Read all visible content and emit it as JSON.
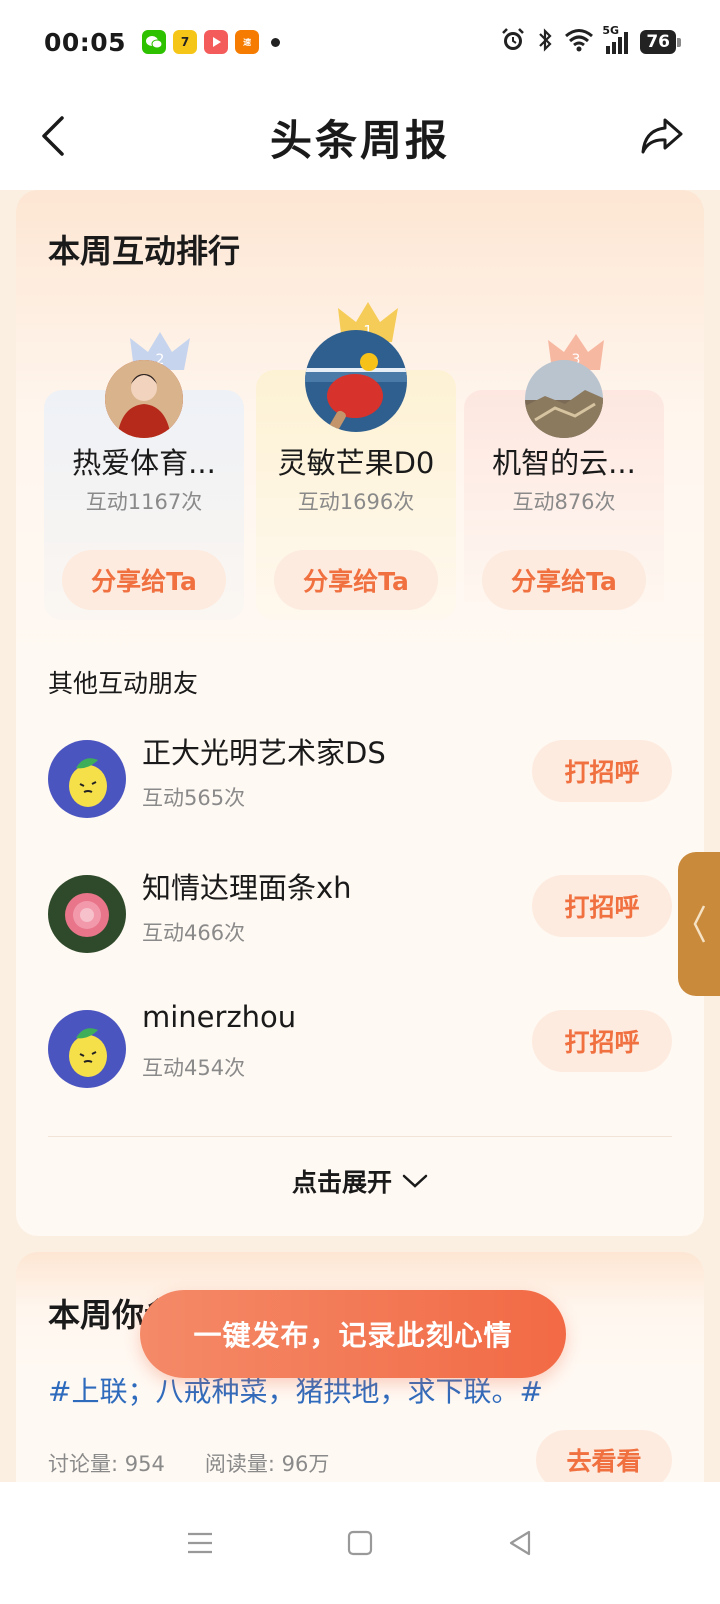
{
  "status_bar": {
    "time": "00:05",
    "battery": "76",
    "network": "5G",
    "apps": [
      "wechat-icon",
      "app-7-icon",
      "video-app-icon",
      "news-app-icon"
    ]
  },
  "header": {
    "title": "头条周报"
  },
  "weekly_ranking": {
    "title": "本周互动排行",
    "top": [
      {
        "rank": "2",
        "name": "热爱体育...",
        "count": "互动1167次",
        "share_label": "分享给Ta"
      },
      {
        "rank": "1",
        "name": "灵敏芒果D0",
        "count": "互动1696次",
        "share_label": "分享给Ta"
      },
      {
        "rank": "3",
        "name": "机智的云...",
        "count": "互动876次",
        "share_label": "分享给Ta"
      }
    ],
    "other_title": "其他互动朋友",
    "others": [
      {
        "name": "正大光明艺术家DS",
        "count": "互动565次",
        "greet_label": "打招呼"
      },
      {
        "name": "知情达理面条xh",
        "count": "互动466次",
        "greet_label": "打招呼"
      },
      {
        "name": "minerzhou",
        "count": "互动454次",
        "greet_label": "打招呼"
      }
    ],
    "expand_label": "点击展开"
  },
  "weekly_topic": {
    "title": "本周你参",
    "hashtag": "#上联；八戒种菜，猪拱地，求下联。#",
    "discussions": "讨论量: 954",
    "reads": "阅读量: 96万",
    "go_label": "去看看"
  },
  "publish": {
    "label": "一键发布，记录此刻心情"
  },
  "colors": {
    "accent": "#f07040",
    "pill_bg": "#fdebdf",
    "hashtag": "#2f6bbd",
    "side_tab": "#c98a3c"
  }
}
